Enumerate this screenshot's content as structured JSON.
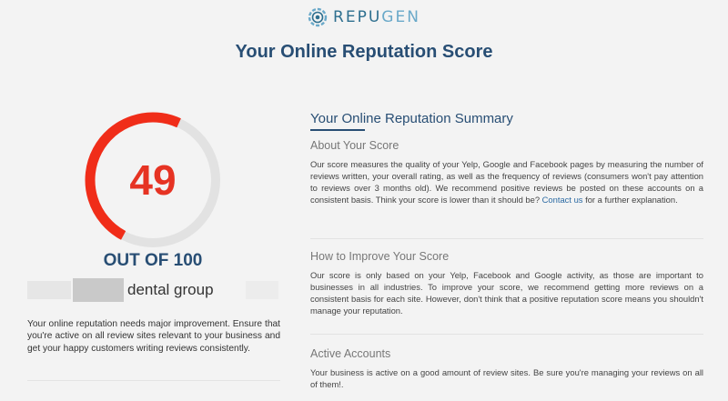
{
  "brand": {
    "name_part1": "REPU",
    "name_part2": "GEN"
  },
  "page": {
    "title": "Your Online Reputation Score"
  },
  "score": {
    "value": "49",
    "fraction": 0.49,
    "out_of_label": "OUT OF 100",
    "ring_color": "#f02d19",
    "track_color": "#e2e2e2"
  },
  "business": {
    "name": "dental group"
  },
  "left": {
    "description": "Your online reputation needs major improvement. Ensure that you're active on all review sites relevant to your business and get your happy customers writing reviews consistently."
  },
  "summary": {
    "title": "Your Online Reputation Summary",
    "about": {
      "heading": "About Your Score",
      "body": "Our score measures the quality of your Yelp, Google and Facebook pages by measuring the number of reviews written, your overall rating, as well as the frequency of reviews (consumers won't pay attention to reviews over 3 months old). We recommend positive reviews be posted on these accounts on a consistent basis. Think your score is lower than it should be?",
      "link": "Contact us",
      "tail": "for a further explanation."
    },
    "improve": {
      "heading": "How to Improve Your Score",
      "body": "Our score is only based on your Yelp, Facebook and Google activity, as those are important to businesses in all industries. To improve your score, we recommend getting more reviews on a consistent basis for each site. However, don't think that a positive reputation score means you shouldn't manage your reputation."
    },
    "accounts": {
      "heading": "Active Accounts",
      "body": "Your business is active on a good amount of review sites. Be sure you're managing your reviews on all of them!."
    }
  }
}
